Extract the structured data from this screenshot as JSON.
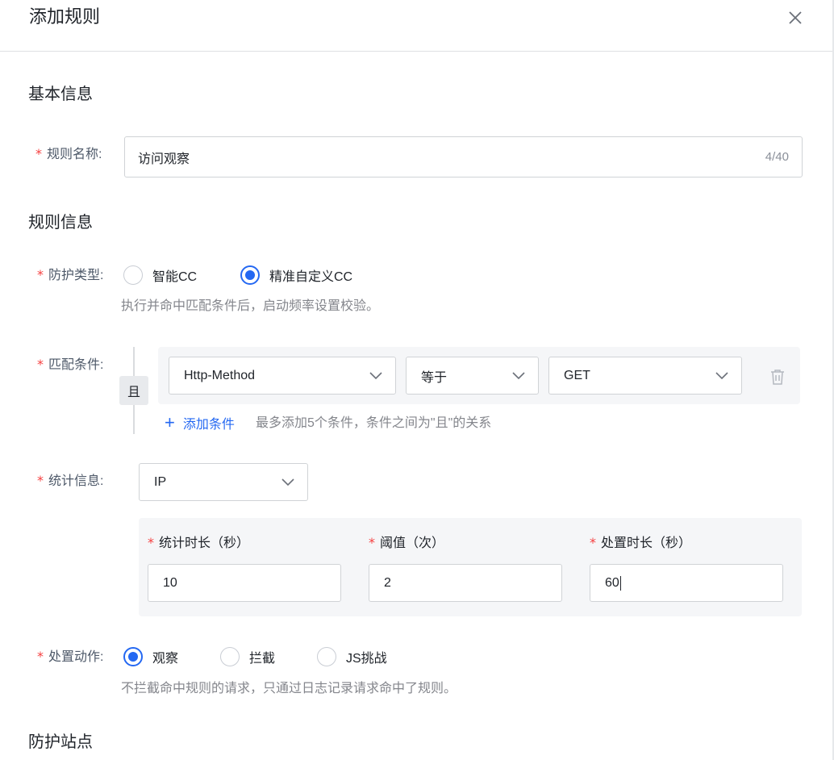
{
  "dialog": {
    "title": "添加规则",
    "close_icon": "close-icon"
  },
  "basic_section": {
    "title": "基本信息"
  },
  "rule_name": {
    "label": "规则名称:",
    "value": "访问观察",
    "counter": "4/40"
  },
  "rule_info_section": {
    "title": "规则信息"
  },
  "protection_type": {
    "label": "防护类型:",
    "options": [
      {
        "label": "智能CC",
        "checked": false
      },
      {
        "label": "精准自定义CC",
        "checked": true
      }
    ],
    "hint": "执行并命中匹配条件后，启动频率设置校验。"
  },
  "match_condition": {
    "label": "匹配条件:",
    "logic": "且",
    "field": "Http-Method",
    "operator": "等于",
    "value": "GET",
    "add_label": "添加条件",
    "add_hint": "最多添加5个条件，条件之间为\"且\"的关系"
  },
  "statistics": {
    "label": "统计信息:",
    "dimension": "IP",
    "duration": {
      "label": "统计时长（秒）",
      "value": "10"
    },
    "threshold": {
      "label": "阈值（次）",
      "value": "2"
    },
    "action_duration": {
      "label": "处置时长（秒）",
      "value": "60"
    }
  },
  "action": {
    "label": "处置动作:",
    "options": [
      {
        "label": "观察",
        "checked": true
      },
      {
        "label": "拦截",
        "checked": false
      },
      {
        "label": "JS挑战",
        "checked": false
      }
    ],
    "hint": "不拦截命中规则的请求，只通过日志记录请求命中了规则。"
  },
  "protected_sites_section": {
    "title": "防护站点"
  },
  "colors": {
    "primary": "#2468f2",
    "required": "#f53f3f",
    "panel": "#f5f6f8"
  }
}
